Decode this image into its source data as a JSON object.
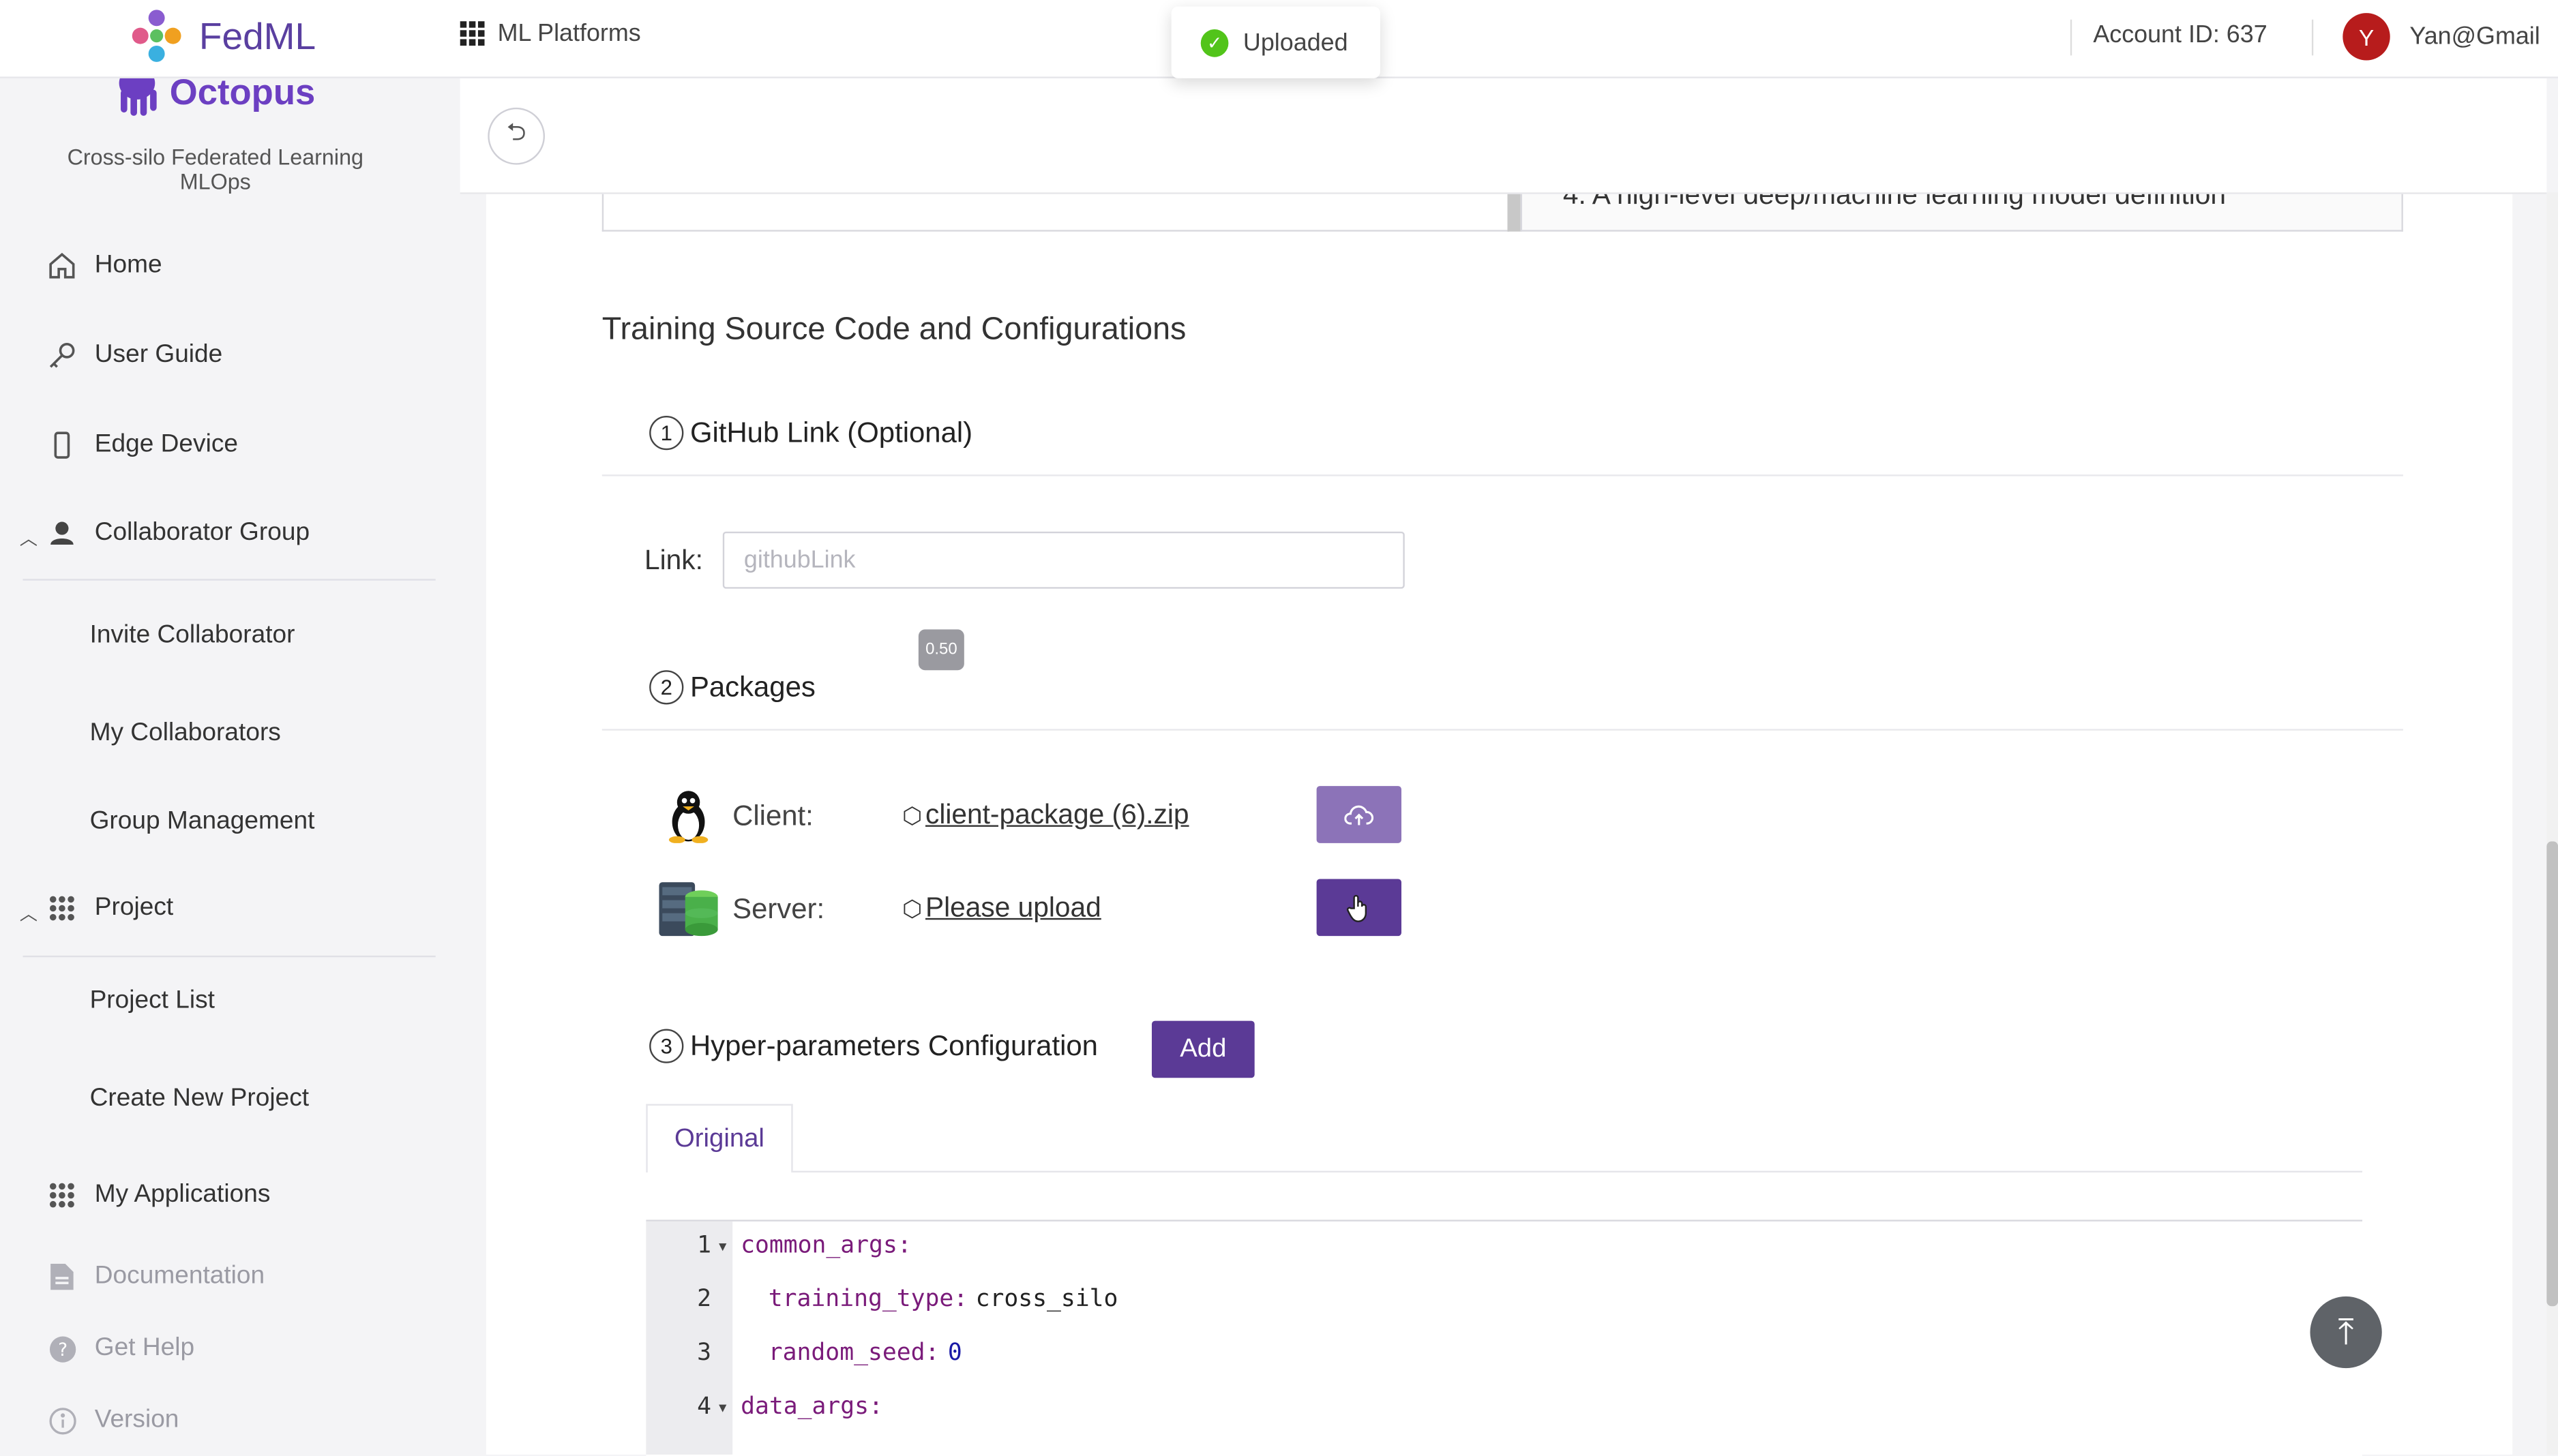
{
  "header": {
    "brand": "FedML",
    "platforms_label": "ML Platforms",
    "account_id": "Account ID: 637",
    "avatar_initial": "Y",
    "user_name": "Yan@Gmail"
  },
  "toast": {
    "message": "Uploaded"
  },
  "sidebar": {
    "logo_text": "Octopus",
    "subtitle": "Cross-silo Federated Learning MLOps",
    "home": "Home",
    "user_guide": "User Guide",
    "edge_device": "Edge Device",
    "collaborator_group": "Collaborator Group",
    "invite_collaborator": "Invite Collaborator",
    "my_collaborators": "My Collaborators",
    "group_management": "Group Management",
    "project": "Project",
    "project_list": "Project List",
    "create_new_project": "Create New Project",
    "my_applications": "My Applications",
    "documentation": "Documentation",
    "get_help": "Get Help",
    "version": "Version"
  },
  "main": {
    "prev_text": "4. A high-level deep/machine learning model definition",
    "section_title": "Training Source Code and Configurations",
    "step1": {
      "num": "1",
      "title": "GitHub Link (Optional)"
    },
    "link_label": "Link:",
    "link_placeholder": "githubLink",
    "badge": "0.50",
    "step2": {
      "num": "2",
      "title": "Packages"
    },
    "client_label": "Client:",
    "client_file": "client-package (6).zip",
    "server_label": "Server:",
    "server_file": "Please upload",
    "step3": {
      "num": "3",
      "title": "Hyper-parameters Configuration"
    },
    "add_label": "Add",
    "tab_original": "Original"
  },
  "code": {
    "lines": [
      {
        "no": "1",
        "key": "common_args:",
        "val": ""
      },
      {
        "no": "2",
        "key": "training_type:",
        "val": "cross_silo"
      },
      {
        "no": "3",
        "key": "random_seed:",
        "val": "0"
      },
      {
        "no": "4",
        "key": "data_args:",
        "val": ""
      }
    ]
  },
  "colors": {
    "accent": "#5b3a96",
    "accent_light": "#8c73b8",
    "success": "#52c41a",
    "avatar": "#b71c1c"
  }
}
